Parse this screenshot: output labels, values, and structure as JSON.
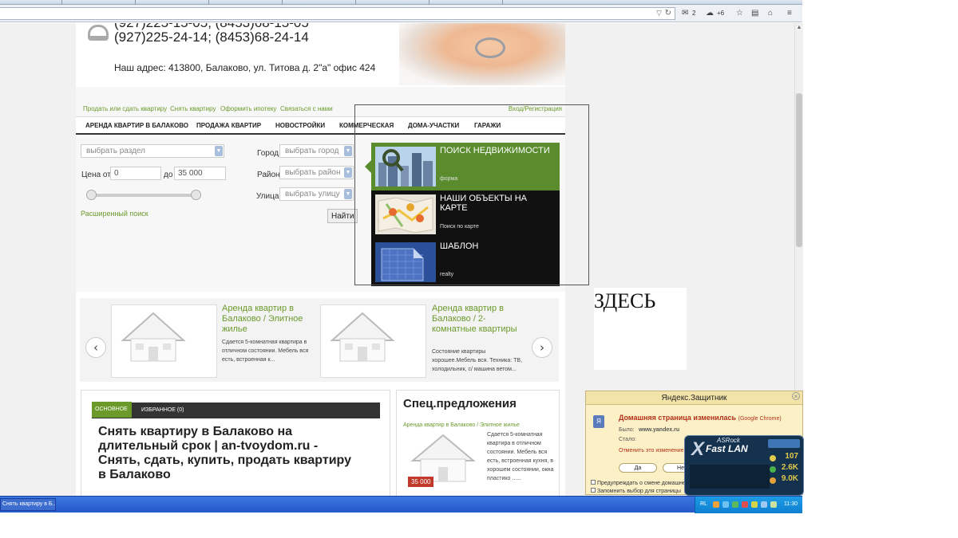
{
  "browser": {
    "mail_count": "2",
    "ext_count": "+6"
  },
  "header": {
    "phone1": "(927)225-15-05; (8453)68-15-05",
    "phone2": "(927)225-24-14; (8453)68-24-14",
    "address": "Наш адрес: 413800, Балаково, ул. Титова д. 2\"а\" офис 424"
  },
  "toplinks": {
    "items": [
      "Продать или сдать квартиру",
      "Снять квартиру",
      "Оформить ипотеку",
      "Связаться с нами"
    ],
    "login": "Вход/Регистрация"
  },
  "nav": {
    "items": [
      "АРЕНДА КВАРТИР В БАЛАКОВО",
      "ПРОДАЖА КВАРТИР",
      "НОВОСТРОЙКИ",
      "КОММЕРЧЕСКАЯ",
      "ДОМА-УЧАСТКИ",
      "ГАРАЖИ"
    ]
  },
  "search": {
    "section_placeholder": "выбрать раздел",
    "price_from_label": "Цена от",
    "price_from_value": "0",
    "price_to_label": "до",
    "price_to_value": "35 000",
    "city_label": "Город",
    "city_placeholder": "выбрать город",
    "district_label": "Район",
    "district_placeholder": "выбрать район",
    "street_label": "Улица",
    "street_placeholder": "выбрать улицу",
    "advanced_link": "Расширенный поиск",
    "find_button": "Найти"
  },
  "menu": {
    "items": [
      {
        "title": "ПОИСК НЕДВИЖИМОСТИ",
        "sub": "форма"
      },
      {
        "title": "НАШИ ОБЪЕКТЫ НА КАРТЕ",
        "sub": "Поиск по карте"
      },
      {
        "title": "ШАБЛОН",
        "sub": "realty"
      }
    ]
  },
  "carousel": {
    "cards": [
      {
        "title": "Аренда квартир в Балаково / Элитное жилье",
        "text": "Сдается 5-комнатная квартира в отличном состоянии. Мебель вся есть, встроенная к..."
      },
      {
        "title": "Аренда квартир в Балаково / 2-комнатные квартиры",
        "text": "Состояние квартиры хорошее.Мебель вся. Техника: ТВ, холодильник, с/ машина ветом..."
      }
    ]
  },
  "tabs": {
    "main": "ОСНОВНОЕ",
    "favorites": "ИЗБРАННОЕ (0)"
  },
  "page_title": "Снять квартиру в Балаково на длительный срок | an-tvoydom.ru - Снять, сдать, купить, продать квартиру в Балаково",
  "special": {
    "title": "Спец.предложения",
    "link": "Аренда квартир в Балаково / Элитное жилье",
    "text": "Сдается 5-комнатная квартира в отличном состоянии. Мебель вся есть, встроенная кухня, в хорошем состоянии, окна пластико ......",
    "price": "35 000"
  },
  "annotation": {
    "text": "ЗДЕСЬ"
  },
  "yandex": {
    "title": "Яндекс.Защитник",
    "message": "Домашняя страница изменилась",
    "message_suffix": "(Google Chrome)",
    "was_label": "Было:",
    "was_value": "www.yandex.ru",
    "now_label": "Стало:",
    "undo_link": "Отменить это изменение?",
    "yes_button": "Да",
    "no_button": "Нет",
    "check1": "Предупреждать о смене домашней страницы",
    "check2": "Запомнить выбор для страницы"
  },
  "asrock": {
    "brand": "ASRock",
    "product": "Fast LAN",
    "values": [
      "107",
      "2.6K",
      "9.0K"
    ]
  },
  "taskbar": {
    "task": "Снять квартиру в Б...",
    "lang": "RL",
    "time": "11:30"
  },
  "colors": {
    "accent_green": "#6b9a2b",
    "menu_active": "#5a8c2e",
    "price_red": "#c0392b",
    "taskbar_blue": "#2459c9"
  }
}
